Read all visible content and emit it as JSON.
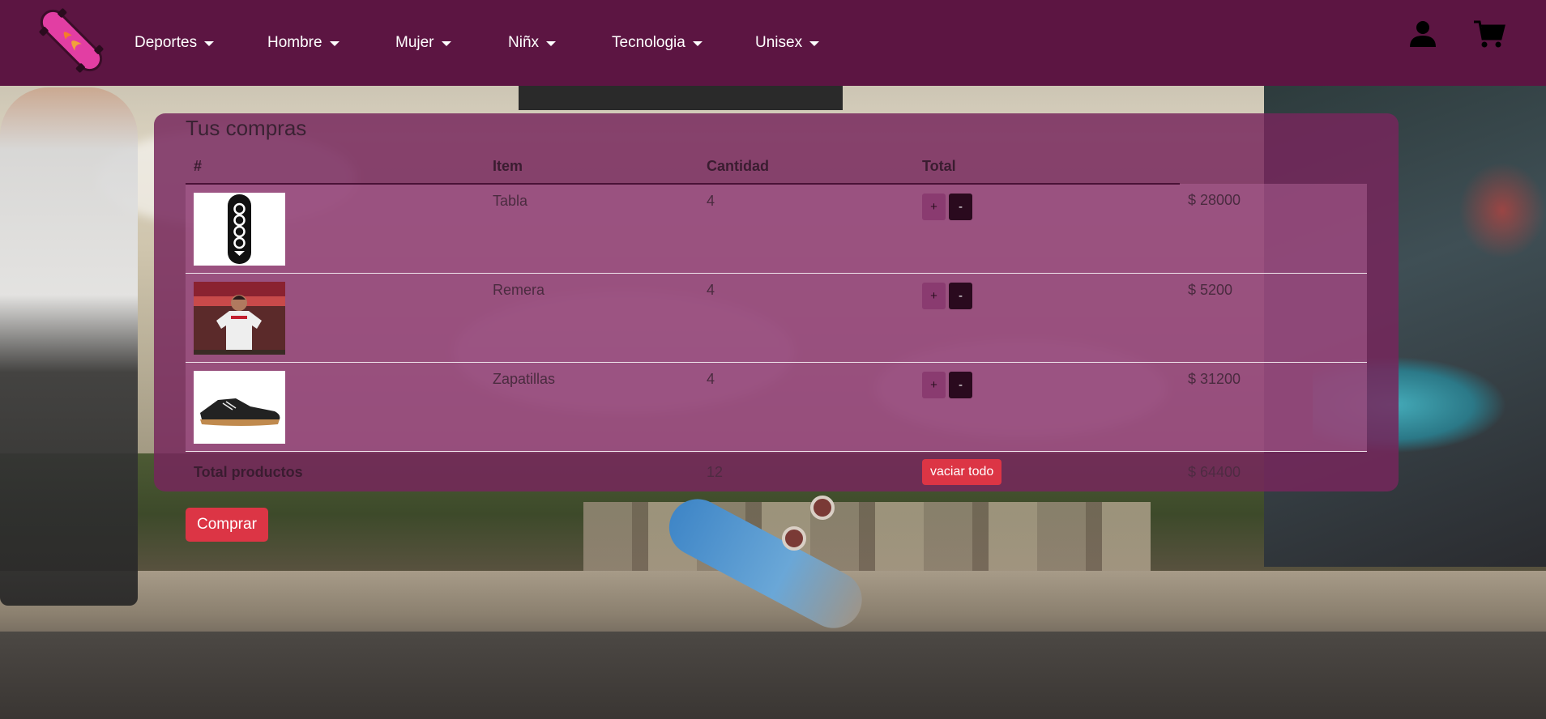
{
  "nav": {
    "items": [
      {
        "label": "Deportes"
      },
      {
        "label": "Hombre"
      },
      {
        "label": "Mujer"
      },
      {
        "label": "Niñx"
      },
      {
        "label": "Tecnologia"
      },
      {
        "label": "Unisex"
      }
    ],
    "logo_icon": "skateboard-logo-icon",
    "user_icon": "user-icon",
    "cart_icon": "cart-icon"
  },
  "cart": {
    "title": "Tus compras",
    "headers": {
      "num": "#",
      "item": "Item",
      "qty": "Cantidad",
      "total": "Total"
    },
    "rows": [
      {
        "item": "Tabla",
        "qty": "4",
        "plus": "+",
        "minus": "-",
        "total": "$ 28000"
      },
      {
        "item": "Remera",
        "qty": "4",
        "plus": "+",
        "minus": "-",
        "total": "$ 5200"
      },
      {
        "item": "Zapatillas",
        "qty": "4",
        "plus": "+",
        "minus": "-",
        "total": "$ 31200"
      }
    ],
    "footer": {
      "label": "Total productos",
      "qty": "12",
      "clear": "vaciar todo",
      "total": "$ 64400"
    },
    "buy": "Comprar"
  },
  "colors": {
    "navbar": "#5c1542",
    "accent": "#dc3545",
    "logo": "#e23ea3"
  }
}
